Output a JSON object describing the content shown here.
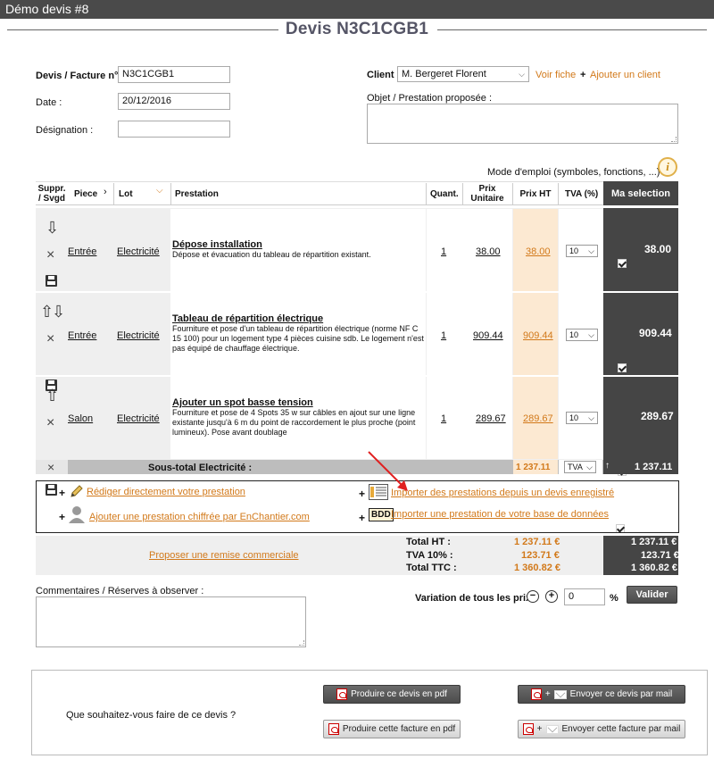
{
  "window": {
    "title": "Démo devis #8"
  },
  "heading": "Devis N3C1CGB1",
  "form": {
    "devis_label": "Devis / Facture n° :",
    "devis_value": "N3C1CGB1",
    "date_label": "Date :",
    "date_value": "20/12/2016",
    "designation_label": "Désignation :",
    "designation_value": "",
    "client_label": "Client :",
    "client_value": "M. Bergeret Florent",
    "voir_fiche": "Voir fiche",
    "add_client": "Ajouter un client",
    "objet_label": "Objet / Prestation proposée :",
    "objet_value": ""
  },
  "mode_emploi": "Mode d'emploi (symboles, fonctions, ...) :",
  "table": {
    "headers": {
      "suppr": "Suppr. / Svgd",
      "piece": "Piece",
      "lot": "Lot",
      "prestation": "Prestation",
      "quant": "Quant.",
      "prix_unitaire": "Prix Unitaire",
      "prix_ht": "Prix HT",
      "tva": "TVA (%)",
      "ma_selection": "Ma selection"
    },
    "rows": [
      {
        "piece": "Entrée",
        "lot": "Electricité",
        "title": "Dépose installation",
        "desc": "Dépose et évacuation du tableau de répartition existant.",
        "quant": "1",
        "pu": "38.00",
        "ht": "38.00",
        "tva": "10",
        "sel": "38.00"
      },
      {
        "piece": "Entrée",
        "lot": "Electricité",
        "title": "Tableau de répartition électrique",
        "desc": "Fourniture et pose d'un tableau de répartition électrique (norme NF C 15 100) pour un logement type 4 pièces cuisine sdb. Le logement n'est pas équipé de chauffage électrique.",
        "quant": "1",
        "pu": "909.44",
        "ht": "909.44",
        "tva": "10",
        "sel": "909.44"
      },
      {
        "piece": "Salon",
        "lot": "Electricité",
        "title": "Ajouter un spot basse tension",
        "desc": "Fourniture et pose de 4 Spots 35 w sur câbles en ajout sur une ligne existante jusqu'à 6 m du point de raccordement le plus proche (point lumineux). Pose avant doublage",
        "quant": "1",
        "pu": "289.67",
        "ht": "289.67",
        "tva": "10",
        "sel": "289.67"
      }
    ],
    "subtotal": {
      "label": "Sous-total Electricité :",
      "ht": "1 237.11",
      "tva": "TVA",
      "sel": "1 237.11"
    }
  },
  "actions": {
    "rediger": "Rédiger directement votre prestation",
    "ajouter_enchantier": "Ajouter une prestation chiffrée par EnChantier.com",
    "importer_devis": "Importer des prestations depuis un devis enregistré",
    "importer_bdd": "Importer une prestation de votre base de données",
    "bdd_badge": "BDD",
    "plus": "+"
  },
  "totals": {
    "remise": "Proposer une remise commerciale",
    "ht_label": "Total HT :",
    "ht": "1 237.11 €",
    "ht_sel": "1 237.11 €",
    "tva_label": "TVA 10% :",
    "tva": "123.71 €",
    "tva_sel": "123.71 €",
    "ttc_label": "Total TTC :",
    "ttc": "1 360.82 €",
    "ttc_sel": "1 360.82 €"
  },
  "comments_label": "Commentaires / Réserves à observer :",
  "variation": {
    "label": "Variation de tous les prix :",
    "minus": "−",
    "plus": "+",
    "value": "0",
    "unit": "%",
    "valider": "Valider"
  },
  "bottom": {
    "question": "Que souhaitez-vous faire de ce devis ?",
    "pdf_devis": "Produire ce devis en pdf",
    "mail_devis": "Envoyer ce devis par mail",
    "pdf_facture": "Produire cette facture en pdf",
    "mail_facture": "Envoyer cette facture par mail",
    "plus": "+"
  },
  "colors": {
    "accent": "#d2791a",
    "dark": "#454545",
    "red_arrow": "#e02020"
  }
}
